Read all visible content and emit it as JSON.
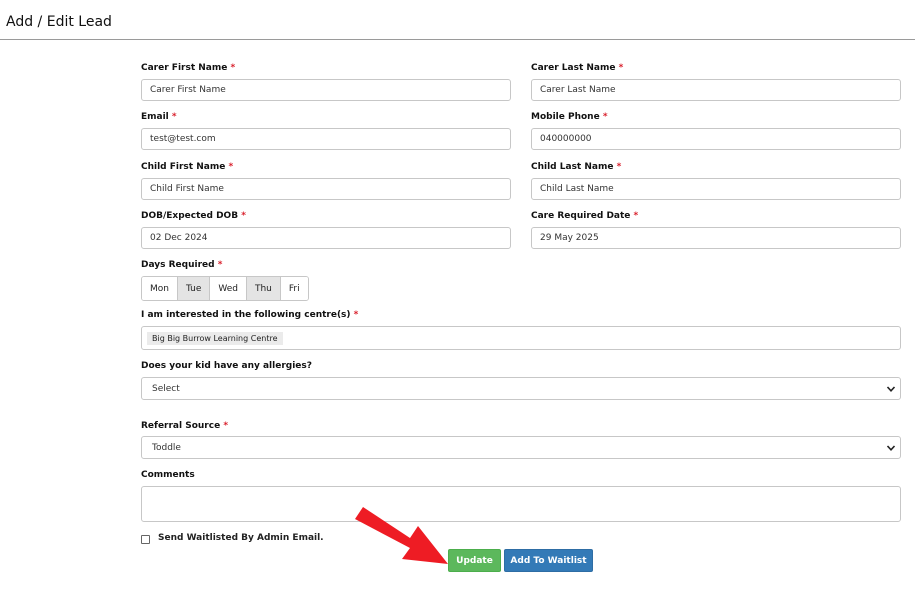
{
  "page": {
    "title": "Add / Edit Lead"
  },
  "form": {
    "carer_first_name": {
      "label": "Carer First Name",
      "value": "Carer First Name"
    },
    "carer_last_name": {
      "label": "Carer Last Name",
      "value": "Carer Last Name"
    },
    "email": {
      "label": "Email",
      "value": "test@test.com"
    },
    "mobile_phone": {
      "label": "Mobile Phone",
      "value": "040000000"
    },
    "child_first_name": {
      "label": "Child First Name",
      "value": "Child First Name"
    },
    "child_last_name": {
      "label": "Child Last Name",
      "value": "Child Last Name"
    },
    "dob": {
      "label": "DOB/Expected DOB",
      "value": "02 Dec 2024"
    },
    "care_required_date": {
      "label": "Care Required Date",
      "value": "29 May 2025"
    },
    "days_required": {
      "label": "Days Required",
      "days": [
        "Mon",
        "Tue",
        "Wed",
        "Thu",
        "Fri"
      ],
      "selected": [
        "Tue",
        "Thu"
      ]
    },
    "centres": {
      "label": "I am interested in the following centre(s)",
      "selected": [
        "Big Big Burrow Learning Centre"
      ]
    },
    "allergies": {
      "label": "Does your kid have any allergies?",
      "value": "Select"
    },
    "referral_source": {
      "label": "Referral Source",
      "value": "Toddle"
    },
    "comments": {
      "label": "Comments",
      "value": ""
    },
    "send_waitlisted_email": {
      "label": "Send Waitlisted By Admin Email.",
      "checked": false
    },
    "required_marker": "*"
  },
  "actions": {
    "update_label": "Update",
    "waitlist_label": "Add To Waitlist"
  },
  "colors": {
    "update_button": "#5cb85c",
    "waitlist_button": "#337ab7",
    "required_asterisk": "#d9202c",
    "annotation_arrow": "#ee1c24"
  }
}
